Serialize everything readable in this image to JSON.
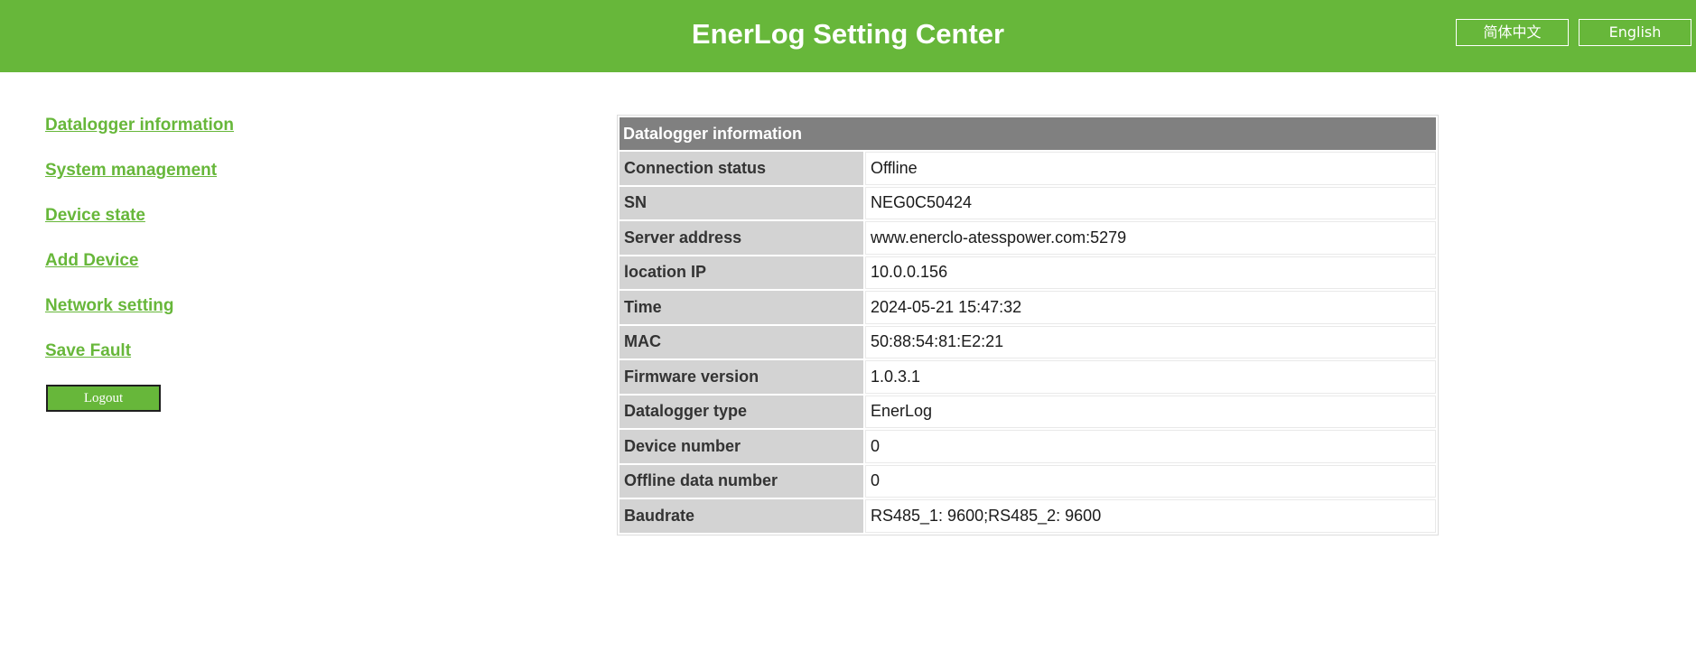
{
  "header": {
    "title": "EnerLog Setting Center",
    "lang_cn": "简体中文",
    "lang_en": "English",
    "background_color": "#67b73a"
  },
  "sidebar": {
    "items": [
      {
        "label": "Datalogger information"
      },
      {
        "label": "System management"
      },
      {
        "label": "Device state"
      },
      {
        "label": "Add Device"
      },
      {
        "label": "Network setting"
      },
      {
        "label": "Save Fault"
      }
    ],
    "logout_label": "Logout",
    "link_color": "#67b73a"
  },
  "info_table": {
    "title": "Datalogger information",
    "rows": [
      {
        "label": "Connection status",
        "value": "Offline"
      },
      {
        "label": "SN",
        "value": "NEG0C50424"
      },
      {
        "label": "Server address",
        "value": "www.enerclo-atesspower.com:5279"
      },
      {
        "label": "location IP",
        "value": "10.0.0.156"
      },
      {
        "label": "Time",
        "value": "2024-05-21 15:47:32"
      },
      {
        "label": "MAC",
        "value": "50:88:54:81:E2:21"
      },
      {
        "label": "Firmware version",
        "value": "1.0.3.1"
      },
      {
        "label": "Datalogger type",
        "value": "EnerLog"
      },
      {
        "label": "Device number",
        "value": "0"
      },
      {
        "label": "Offline data number",
        "value": "0"
      },
      {
        "label": "Baudrate",
        "value": "RS485_1: 9600;RS485_2: 9600"
      }
    ],
    "header_color": "#808080",
    "label_color": "#d3d3d3"
  }
}
